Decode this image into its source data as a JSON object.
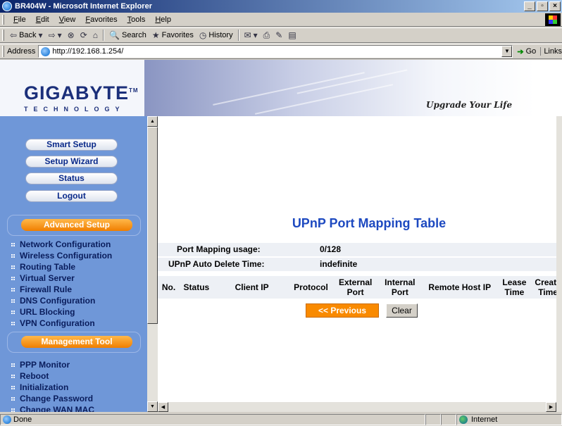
{
  "window": {
    "title": "BR404W - Microsoft Internet Explorer"
  },
  "menu": [
    "File",
    "Edit",
    "View",
    "Favorites",
    "Tools",
    "Help"
  ],
  "toolbar": {
    "back": "Back",
    "search": "Search",
    "favorites": "Favorites",
    "history": "History"
  },
  "address": {
    "label": "Address",
    "url": "http://192.168.1.254/",
    "go": "Go",
    "links": "Links"
  },
  "banner": {
    "logo_main": "GIGABYTE",
    "logo_tm": "TM",
    "logo_sub": "TECHNOLOGY",
    "tagline": "Upgrade Your Life"
  },
  "nav": {
    "buttons": [
      "Smart Setup",
      "Setup Wizard",
      "Status",
      "Logout"
    ],
    "advanced_title": "Advanced Setup",
    "advanced_items": [
      "Network Configuration",
      "Wireless Configuration",
      "Routing Table",
      "Virtual Server",
      "Firewall Rule",
      "DNS Configuration",
      "URL Blocking",
      "VPN Configuration"
    ],
    "management_title": "Management Tool",
    "management_items": [
      "PPP Monitor",
      "Reboot",
      "Initialization",
      "Change Password",
      "Change WAN MAC"
    ]
  },
  "main": {
    "title": "UPnP Port Mapping Table",
    "usage_label": "Port Mapping usage:",
    "usage_value": "0/128",
    "auto_delete_label": "UPnP Auto Delete Time:",
    "auto_delete_value": "indefinite",
    "columns": [
      "No.",
      "Status",
      "Client IP",
      "Protocol",
      "External Port",
      "Internal Port",
      "Remote Host IP",
      "Lease Time",
      "Create Time"
    ],
    "previous_button": "<< Previous",
    "clear_button": "Clear"
  },
  "status": {
    "text": "Done",
    "zone": "Internet"
  }
}
